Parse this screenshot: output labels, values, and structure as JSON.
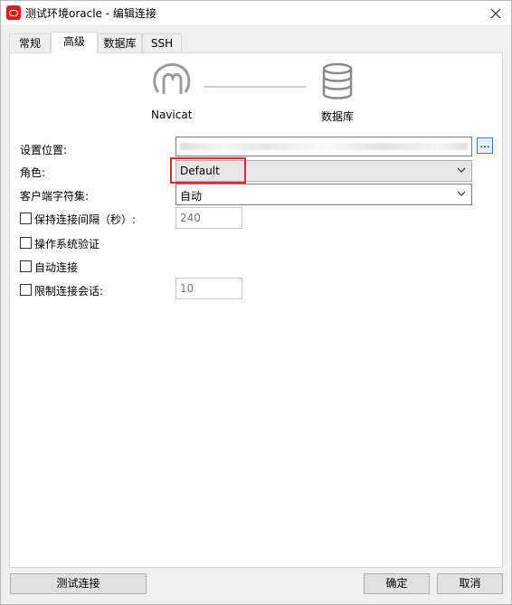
{
  "window": {
    "title": "测试环境oracle - 编辑连接"
  },
  "tabs": [
    {
      "label": "常规"
    },
    {
      "label": "高级"
    },
    {
      "label": "数据库"
    },
    {
      "label": "SSH"
    }
  ],
  "diagram": {
    "left_label": "Navicat",
    "right_label": "数据库"
  },
  "form": {
    "location_label": "设置位置:",
    "role_label": "角色:",
    "role_value": "Default",
    "charset_label": "客户端字符集:",
    "charset_value": "自动",
    "ellipsis": "..."
  },
  "options": {
    "keepalive_label": "保持连接间隔（秒）:",
    "keepalive_value": "240",
    "os_auth_label": "操作系统验证",
    "autoconnect_label": "自动连接",
    "limit_sessions_label": "限制连接会话:",
    "limit_sessions_value": "10"
  },
  "buttons": {
    "test": "测试连接",
    "ok": "确定",
    "cancel": "取消"
  },
  "colors": {
    "highlight": "#e0282d",
    "app_icon": "#d81e1e"
  }
}
